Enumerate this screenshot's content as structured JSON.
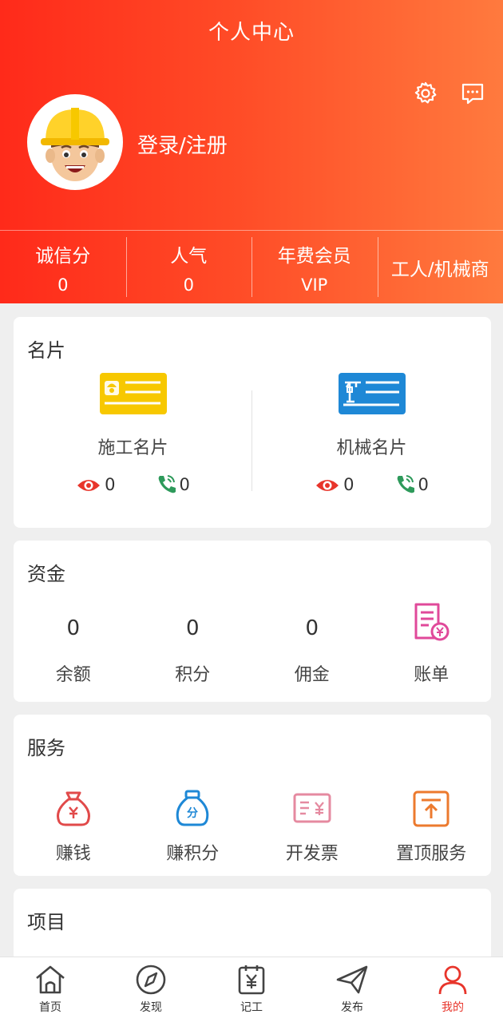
{
  "header": {
    "title": "个人中心",
    "login_text": "登录/注册",
    "settings_icon": "gear-icon",
    "message_icon": "message-icon"
  },
  "stats": [
    {
      "label": "诚信分",
      "value": "0"
    },
    {
      "label": "人气",
      "value": "0"
    },
    {
      "label": "年费会员",
      "value": "VIP"
    },
    {
      "label": "工人/机械商",
      "value": ""
    }
  ],
  "business_card": {
    "title": "名片",
    "items": [
      {
        "name": "施工名片",
        "views": "0",
        "calls": "0",
        "icon": "worker-card-icon",
        "color": "#f7c800"
      },
      {
        "name": "机械名片",
        "views": "0",
        "calls": "0",
        "icon": "crane-card-icon",
        "color": "#1e88d6"
      }
    ]
  },
  "funds": {
    "title": "资金",
    "items": [
      {
        "value": "0",
        "label": "余额"
      },
      {
        "value": "0",
        "label": "积分"
      },
      {
        "value": "0",
        "label": "佣金"
      },
      {
        "value": "",
        "label": "账单",
        "icon": "bill-icon"
      }
    ]
  },
  "services": {
    "title": "服务",
    "items": [
      {
        "label": "赚钱",
        "icon": "money-bag-icon"
      },
      {
        "label": "赚积分",
        "icon": "points-bag-icon"
      },
      {
        "label": "开发票",
        "icon": "invoice-icon"
      },
      {
        "label": "置顶服务",
        "icon": "pin-top-icon"
      }
    ]
  },
  "projects": {
    "title": "项目"
  },
  "tabbar": [
    {
      "label": "首页",
      "icon": "home-icon"
    },
    {
      "label": "发现",
      "icon": "compass-icon"
    },
    {
      "label": "记工",
      "icon": "calendar-yen-icon"
    },
    {
      "label": "发布",
      "icon": "send-icon"
    },
    {
      "label": "我的",
      "icon": "user-icon",
      "active": true
    }
  ],
  "colors": {
    "header_start": "#ff2a1a",
    "header_end": "#ff7a3e",
    "active": "#e8352b"
  }
}
